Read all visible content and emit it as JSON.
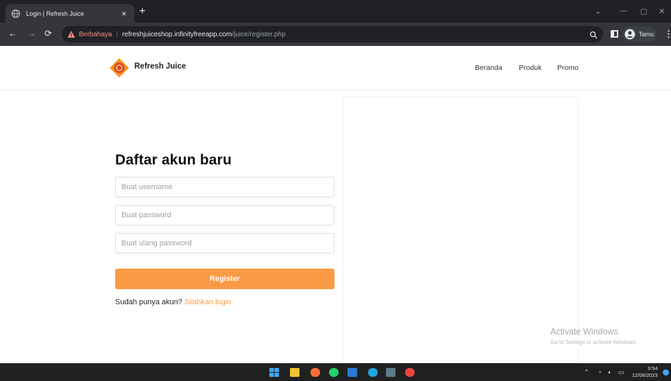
{
  "browser": {
    "tab_title": "Login | Refresh Juice",
    "tab_close_glyph": "×",
    "new_tab_glyph": "+",
    "security_label": "Berbahaya",
    "url_host": "refreshjuiceshop.infinityfreeapp.com",
    "url_path": "/juice/register.php",
    "profile_name": "Tamu"
  },
  "header": {
    "brand": "Refresh Juice",
    "nav": [
      "Beranda",
      "Produk",
      "Promo"
    ]
  },
  "form": {
    "heading": "Daftar akun baru",
    "username_placeholder": "Buat username",
    "password_placeholder": "Buat password",
    "confirm_placeholder": "Buat ulang password",
    "register_label": "Register",
    "have_account_text": "Sudah punya akun?",
    "login_link": "Silahkan login"
  },
  "watermark": {
    "title": "Activate Windows",
    "subtitle": "Go to Settings to activate Windows."
  },
  "taskbar": {
    "time": "9:54",
    "date": "12/08/2023"
  },
  "colors": {
    "accent": "#fa9a44",
    "warning": "#f28b82"
  },
  "icons": [
    "globe-icon",
    "warning-icon",
    "zoom-icon",
    "side-panel-icon",
    "avatar-icon",
    "juice-logo-icon",
    "windows-start-icon"
  ]
}
